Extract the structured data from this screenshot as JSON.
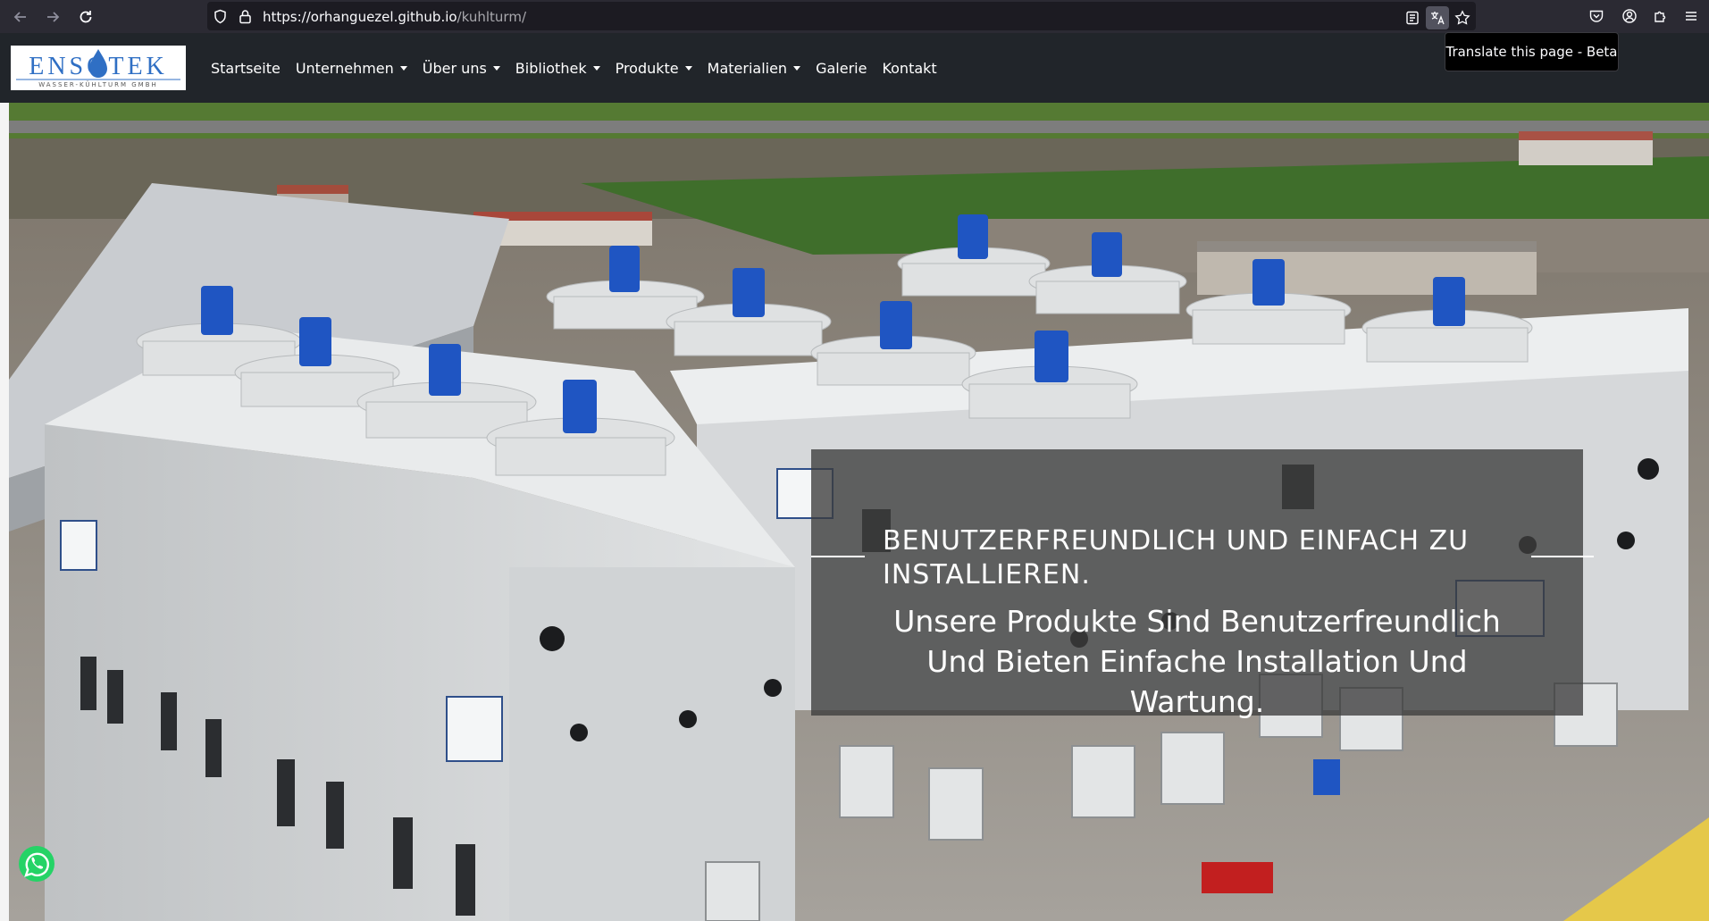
{
  "browser": {
    "url_host": "https://orhanguezel.github.io",
    "url_path": "/kuhlturm/",
    "tooltip": "Translate this page - Beta"
  },
  "navbar": {
    "logo": {
      "main": "ENSOTEK",
      "sub": "WASSER-KÜHLTURM GMBH"
    },
    "items": [
      {
        "label": "Startseite",
        "dropdown": false
      },
      {
        "label": "Unternehmen",
        "dropdown": true
      },
      {
        "label": "Über uns",
        "dropdown": true
      },
      {
        "label": "Bibliothek",
        "dropdown": true
      },
      {
        "label": "Produkte",
        "dropdown": true
      },
      {
        "label": "Materialien",
        "dropdown": true
      },
      {
        "label": "Galerie",
        "dropdown": false
      },
      {
        "label": "Kontakt",
        "dropdown": false
      }
    ]
  },
  "hero": {
    "title": "BENUTZERFREUNDLICH UND EINFACH ZU INSTALLIEREN.",
    "text": "Unsere Produkte Sind Benutzerfreundlich Und Bieten Einfache Installation Und Wartung."
  },
  "colors": {
    "chrome": "#2b2a33",
    "navbar": "#21252a",
    "whatsapp": "#25d366",
    "brand_blue": "#2f6fc4"
  },
  "icons": [
    "back-icon",
    "forward-icon",
    "reload-icon",
    "shield-icon",
    "lock-icon",
    "reader-view-icon",
    "translate-icon",
    "bookmark-star-icon",
    "pocket-icon",
    "account-icon",
    "extensions-icon",
    "menu-icon",
    "whatsapp-icon"
  ]
}
